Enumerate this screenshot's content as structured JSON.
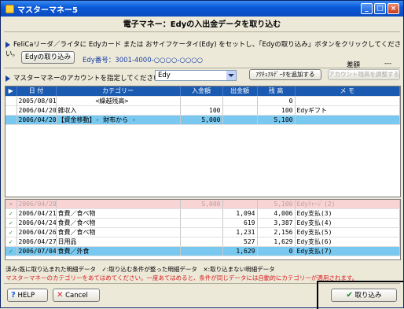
{
  "window": {
    "title": "マスターマネー5"
  },
  "header": {
    "title": "電子マネー：Edyの入出金データを取り込む"
  },
  "instruction": "FeliCaリーダ／ライタに Edyカード または おサイフケータイ(Edy) をセットし、「Edyの取り込み」ボタンをクリックしてください。",
  "edy_import_button": "Edyの取り込み",
  "edy_number": "Edy番号：3001-4000-○○○○-○○○○",
  "zangaku_label": "差額",
  "zangaku_value": "---",
  "account_instruction": "マスターマネーのアカウントを指定してください。",
  "account_select": "Edy",
  "add_actual_button": "ｱｸﾁｭｱﾙﾃﾞｰﾀを追加する",
  "adjust_balance_button": "アカウント残高を調整する",
  "columns": [
    "",
    "日 付",
    "カテゴリー",
    "入金額",
    "出金額",
    "残 高",
    "メ モ"
  ],
  "top_rows": [
    {
      "date": "2005/08/01",
      "category": "　　　　　　<繰越残高>",
      "in": "",
      "out": "",
      "bal": "0",
      "memo": ""
    },
    {
      "date": "2006/04/20",
      "category": "雑収入",
      "in": "100",
      "out": "",
      "bal": "100",
      "memo": "Edyギフト"
    },
    {
      "date": "2006/04/20",
      "category": "【資金移動】- 財布から -",
      "in": "5,000",
      "out": "",
      "bal": "5,100",
      "memo": ""
    }
  ],
  "bottom_rows": [
    {
      "mark": "×",
      "date": "2006/04/20",
      "category": "",
      "in": "5,000",
      "out": "",
      "bal": "5,100",
      "memo": "Edyﾁｬｰｼﾞ(2)"
    },
    {
      "mark": "✓",
      "date": "2006/04/21",
      "category": "食費／食べ物",
      "in": "",
      "out": "1,094",
      "bal": "4,006",
      "memo": "Edy支払(3)"
    },
    {
      "mark": "✓",
      "date": "2006/04/24",
      "category": "食費／食べ物",
      "in": "",
      "out": "619",
      "bal": "3,387",
      "memo": "Edy支払(4)"
    },
    {
      "mark": "✓",
      "date": "2006/04/26",
      "category": "食費／食べ物",
      "in": "",
      "out": "1,231",
      "bal": "2,156",
      "memo": "Edy支払(5)"
    },
    {
      "mark": "✓",
      "date": "2006/04/27",
      "category": "日用品",
      "in": "",
      "out": "527",
      "bal": "1,629",
      "memo": "Edy支払(6)"
    },
    {
      "mark": "✓",
      "date": "2006/07/04",
      "category": "食費／外食",
      "in": "",
      "out": "1,629",
      "bal": "0",
      "memo": "Edy支払(7)"
    }
  ],
  "legend": "済み:既に取り込まれた明細データ　✓:取り込む条件が整った明細データ　×:取り込まない明細データ",
  "note": "マスターマネーのカテゴリーをあてはめてください。一度あてはめると、条件が同じデータには自動的にカテゴリーが適用されます。",
  "help_button": "HELP",
  "cancel_button": "Cancel",
  "import_button": "取り込み"
}
